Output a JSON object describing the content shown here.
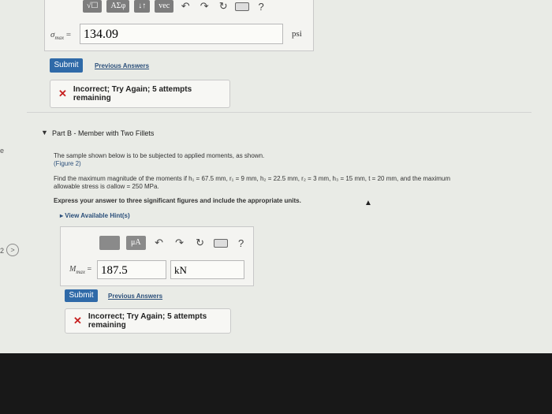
{
  "partA": {
    "toolbar": {
      "btn1": "√☐",
      "btn2": "ΑΣφ",
      "btn3": "↓↑",
      "btn4": "vec",
      "undo_icon": "↶",
      "redo_icon": "↷",
      "reset_icon": "↻",
      "keyboard_icon": "keyboard",
      "help_icon": "?"
    },
    "label_symbol": "σ",
    "label_sub": "max",
    "label_eq": "=",
    "answer_value": "134.09",
    "unit": "psi",
    "submit_label": "Submit",
    "previous_answers_label": "Previous Answers",
    "feedback_text": "Incorrect; Try Again; 5 attempts remaining"
  },
  "partB": {
    "title": "Part B - Member with Two Fillets",
    "intro": "The sample shown below is to be subjected to applied moments, as shown.",
    "figure_link": "(Figure 2)",
    "problem_line1": "Find the maximum magnitude of the moments if h₁ = 67.5 mm, r₁ = 9 mm, h₂ = 22.5 mm, r₂ = 3 mm, h₃ = 15 mm, t = 20 mm, and the maximum",
    "problem_line2": "allowable stress is σallow = 250 MPa.",
    "instruction": "Express your answer to three significant figures and include the appropriate units.",
    "hint_label": "View Available Hint(s)",
    "toolbar": {
      "mu_label": "μA",
      "undo_icon": "↶",
      "redo_icon": "↷",
      "reset_icon": "↻",
      "help_icon": "?"
    },
    "label_symbol": "M",
    "label_sub": "max",
    "label_eq": "=",
    "answer_value": "187.5",
    "unit_value": "kN",
    "submit_label": "Submit",
    "previous_answers_label": "Previous Answers",
    "feedback_text": "Incorrect; Try Again; 5 attempts remaining"
  },
  "margin": {
    "left_text_1": "e",
    "left_text_2": "2",
    "nav_icon": ">"
  },
  "colors": {
    "accent": "#2f6aa8",
    "error": "#c72020"
  }
}
